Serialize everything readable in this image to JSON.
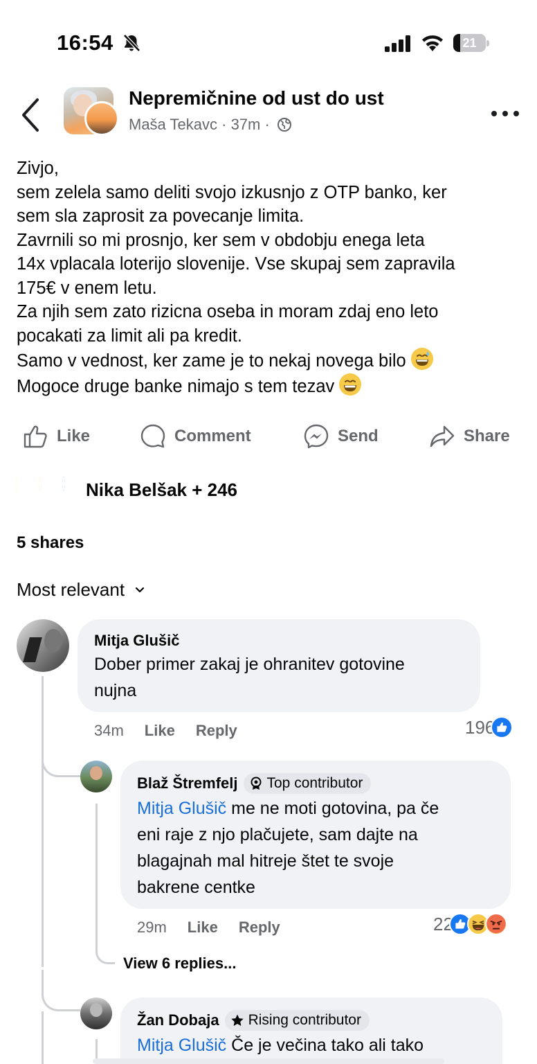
{
  "status_bar": {
    "time": "16:54",
    "battery_level": "21",
    "icons": [
      "bell-muted-icon",
      "cellular-signal-icon",
      "wifi-icon",
      "battery-icon"
    ]
  },
  "post": {
    "group_name": "Nepremičnine od ust do ust",
    "author": "Maša Tekavc",
    "time_ago": "37m",
    "separator": "·",
    "body_lines": [
      "Zivjo,",
      "sem zelela samo deliti svojo izkusnjo z OTP banko, ker",
      "sem sla zaprosit za povecanje limita.",
      "Zavrnili so mi prosnjo, ker sem v obdobju enega leta",
      "14x vplacala loterijo slovenije. Vse skupaj sem zapravila",
      "175€ v enem letu.",
      "Za njih sem zato rizicna oseba in moram zdaj eno leto",
      "pocakati za limit ali pa kredit.",
      "Samo v vednost, ker zame je to nekaj novega bilo",
      "Mogoce druge banke nimajo s tem tezav"
    ],
    "emoji_line_9": "grinning-sweat-emoji",
    "emoji_line_10": "grinning-emoji"
  },
  "actions": {
    "like": "Like",
    "comment": "Comment",
    "send": "Send",
    "share": "Share"
  },
  "reactions": {
    "summary": "Nika Belšak + 246",
    "types": [
      "wow",
      "haha",
      "like"
    ]
  },
  "shares": "5 shares",
  "sort": {
    "label": "Most relevant"
  },
  "comments": [
    {
      "author": "Mitja Glušič",
      "lines": [
        "Dober primer zakaj je ohranitev gotovine",
        "nujna"
      ],
      "time": "34m",
      "like": "Like",
      "reply": "Reply",
      "reaction_count": "196",
      "reaction_types": [
        "like"
      ]
    },
    {
      "author": "Blaž Štremfelj",
      "badge": "Top contributor",
      "mention": "Mitja Glušič",
      "first_line_rest": " me ne moti gotovina, pa če",
      "lines": [
        "eni raje z njo plačujete, sam dajte na",
        "blagajnah mal hitreje štet te svoje",
        "bakrene centke"
      ],
      "time": "29m",
      "like": "Like",
      "reply": "Reply",
      "reaction_count": "22",
      "reaction_types": [
        "like",
        "haha",
        "angry"
      ],
      "view_replies": "View 6 replies..."
    },
    {
      "author": "Žan Dobaja",
      "badge": "Rising contributor",
      "mention": "Mitja Glušič",
      "first_line_rest": " Če je večina tako ali tako"
    }
  ],
  "colors": {
    "accent_blue": "#1877f2",
    "mention_blue": "#1a6ed8",
    "secondary_text": "#65676b",
    "bubble_bg": "#f0f2f5"
  }
}
